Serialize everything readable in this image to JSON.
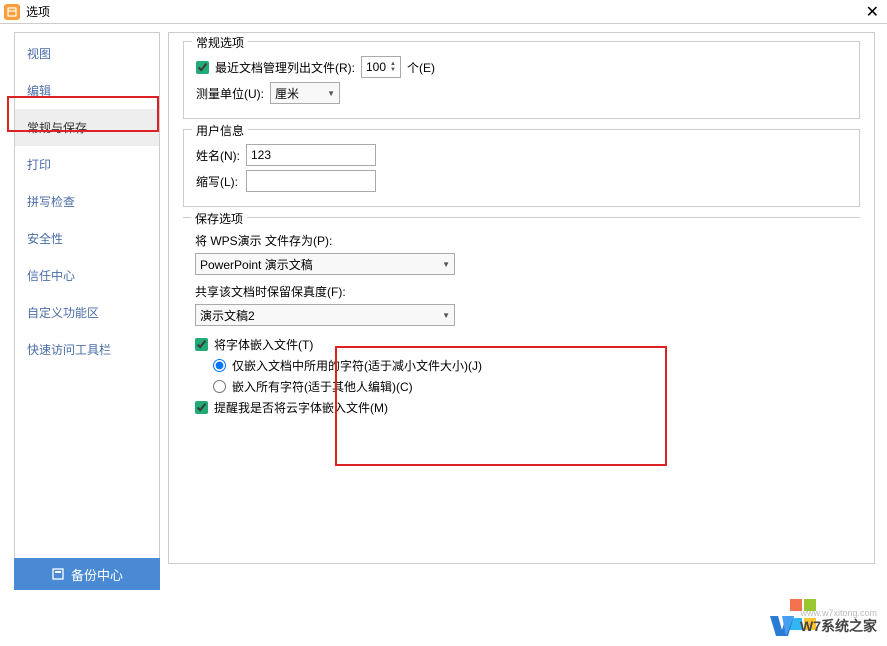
{
  "window": {
    "title": "选项"
  },
  "sidebar": {
    "items": [
      {
        "label": "视图"
      },
      {
        "label": "编辑"
      },
      {
        "label": "常规与保存",
        "selected": true
      },
      {
        "label": "打印"
      },
      {
        "label": "拼写检查"
      },
      {
        "label": "安全性"
      },
      {
        "label": "信任中心"
      },
      {
        "label": "自定义功能区"
      },
      {
        "label": "快速访问工具栏"
      }
    ]
  },
  "general": {
    "group_title": "常规选项",
    "recent_docs_label": "最近文档管理列出文件(R):",
    "recent_docs_value": "100",
    "recent_docs_unit": "个(E)",
    "measure_unit_label": "测量单位(U):",
    "measure_unit_value": "厘米"
  },
  "user_info": {
    "group_title": "用户信息",
    "name_label": "姓名(N):",
    "name_value": "123",
    "initials_label": "缩写(L):",
    "initials_value": ""
  },
  "save": {
    "group_title": "保存选项",
    "save_as_label": "将 WPS演示 文件存为(P):",
    "save_as_value": "PowerPoint 演示文稿",
    "fidelity_label": "共享该文档时保留保真度(F):",
    "fidelity_value": "演示文稿2",
    "embed_fonts_label": "将字体嵌入文件(T)",
    "embed_fonts_checked": true,
    "embed_used_label": "仅嵌入文档中所用的字符(适于减小文件大小)(J)",
    "embed_all_label": "嵌入所有字符(适于其他人编辑)(C)",
    "remind_cloud_label": "提醒我是否将云字体嵌入文件(M)",
    "remind_cloud_checked": true
  },
  "footer": {
    "backup_label": "备份中心"
  },
  "watermark": {
    "text": "W7系统之家",
    "sub": "www.w7xitong.com"
  }
}
